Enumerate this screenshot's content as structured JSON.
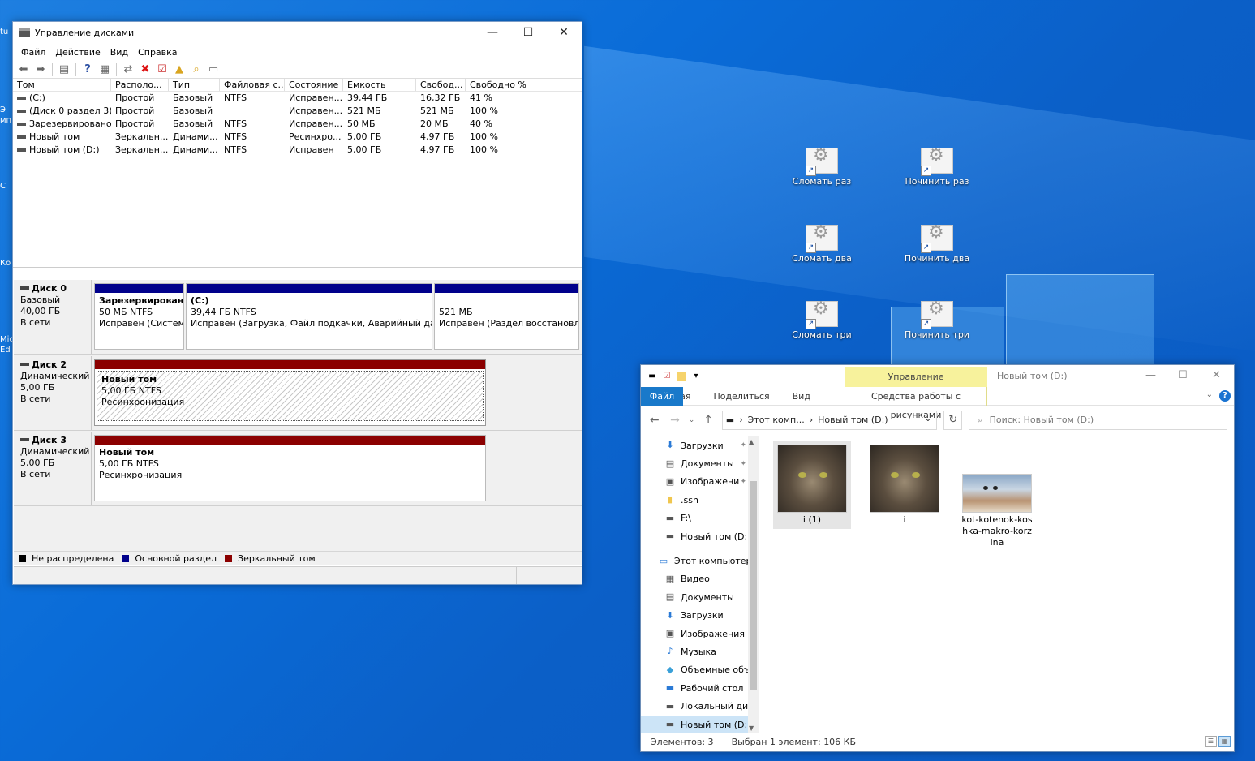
{
  "desktop": {
    "left_edge": [
      "tu",
      "Э",
      "мп",
      "С",
      "Ко",
      "Mic",
      "Ed"
    ],
    "shortcuts": [
      {
        "label": "Сломать раз"
      },
      {
        "label": "Починить раз"
      },
      {
        "label": "Сломать два"
      },
      {
        "label": "Починить два"
      },
      {
        "label": "Сломать три"
      },
      {
        "label": "Починить три"
      }
    ]
  },
  "disk_mgmt": {
    "title": "Управление дисками",
    "window_buttons": {
      "minimize": "—",
      "maximize": "☐",
      "close": "✕"
    },
    "menu": [
      "Файл",
      "Действие",
      "Вид",
      "Справка"
    ],
    "columns": [
      "Том",
      "Располо...",
      "Тип",
      "Файловая с...",
      "Состояние",
      "Емкость",
      "Свобод...",
      "Свободно %"
    ],
    "volumes": [
      [
        "(C:)",
        "Простой",
        "Базовый",
        "NTFS",
        "Исправен...",
        "39,44 ГБ",
        "16,32 ГБ",
        "41 %"
      ],
      [
        "(Диск 0 раздел 3)",
        "Простой",
        "Базовый",
        "",
        "Исправен...",
        "521 МБ",
        "521 МБ",
        "100 %"
      ],
      [
        "Зарезервировано...",
        "Простой",
        "Базовый",
        "NTFS",
        "Исправен...",
        "50 МБ",
        "20 МБ",
        "40 %"
      ],
      [
        "Новый том",
        "Зеркальн...",
        "Динами...",
        "NTFS",
        "Ресинхро...",
        "5,00 ГБ",
        "4,97 ГБ",
        "100 %"
      ],
      [
        "Новый том (D:)",
        "Зеркальн...",
        "Динами...",
        "NTFS",
        "Исправен",
        "5,00 ГБ",
        "4,97 ГБ",
        "100 %"
      ]
    ],
    "disks": [
      {
        "name": "Диск 0",
        "type": "Базовый",
        "size": "40,00 ГБ",
        "status": "В сети",
        "partitions": [
          {
            "name": "Зарезервировано",
            "size": "50 МБ NTFS",
            "state": "Исправен (Система"
          },
          {
            "name": "(C:)",
            "size": "39,44 ГБ NTFS",
            "state": "Исправен (Загрузка, Файл подкачки, Аварийный дамп п"
          },
          {
            "name": "",
            "size": "521 МБ",
            "state": "Исправен (Раздел восстановлен"
          }
        ]
      },
      {
        "name": "Диск 2",
        "type": "Динамический",
        "size": "5,00 ГБ",
        "status": "В сети",
        "partitions": [
          {
            "name": "Новый том",
            "size": "5,00 ГБ NTFS",
            "state": "Ресинхронизация"
          }
        ]
      },
      {
        "name": "Диск 3",
        "type": "Динамический",
        "size": "5,00 ГБ",
        "status": "В сети",
        "partitions": [
          {
            "name": "Новый том",
            "size": "5,00 ГБ NTFS",
            "state": "Ресинхронизация"
          }
        ]
      }
    ],
    "legend": [
      {
        "label": "Не распределена",
        "color": "#000000"
      },
      {
        "label": "Основной раздел",
        "color": "#00008b"
      },
      {
        "label": "Зеркальный том",
        "color": "#8b0000"
      }
    ]
  },
  "explorer": {
    "context_tab": "Управление",
    "title": "Новый том (D:)",
    "ribbon_tabs": [
      "Файл",
      "Главная",
      "Поделиться",
      "Вид"
    ],
    "tools_tab": "Средства работы с рисунками",
    "address": {
      "crumb1": "Этот комп...",
      "crumb2": "Новый том (D:)"
    },
    "search_placeholder": "Поиск: Новый том (D:)",
    "nav": [
      {
        "label": "Загрузки",
        "icon": "download-icon",
        "pinned": true
      },
      {
        "label": "Документы",
        "icon": "document-icon",
        "pinned": true
      },
      {
        "label": "Изображени",
        "icon": "pictures-icon",
        "pinned": true
      },
      {
        "label": ".ssh",
        "icon": "folder-icon",
        "pinned": false
      },
      {
        "label": "F:\\",
        "icon": "drive-icon",
        "pinned": false
      },
      {
        "label": "Новый том (D:)",
        "icon": "drive-icon",
        "pinned": false
      },
      {
        "label": "Этот компьютер",
        "icon": "computer-icon",
        "pinned": false,
        "top": true
      },
      {
        "label": "Видео",
        "icon": "video-icon",
        "pinned": false
      },
      {
        "label": "Документы",
        "icon": "document-icon",
        "pinned": false
      },
      {
        "label": "Загрузки",
        "icon": "download-icon",
        "pinned": false
      },
      {
        "label": "Изображения",
        "icon": "pictures-icon",
        "pinned": false
      },
      {
        "label": "Музыка",
        "icon": "music-icon",
        "pinned": false
      },
      {
        "label": "Объемные объ",
        "icon": "3d-objects-icon",
        "pinned": false
      },
      {
        "label": "Рабочий стол",
        "icon": "desktop-icon",
        "pinned": false
      },
      {
        "label": "Локальный дис",
        "icon": "drive-icon",
        "pinned": false
      },
      {
        "label": "Новый том (D:)",
        "icon": "drive-icon",
        "pinned": false,
        "selected": true
      }
    ],
    "files": [
      {
        "name": "i (1)",
        "selected": true
      },
      {
        "name": "i",
        "selected": false
      },
      {
        "name": "kot-kotenok-koshka-makro-korzina",
        "selected": false
      }
    ],
    "status": {
      "count": "Элементов: 3",
      "selection": "Выбран 1 элемент: 106 КБ"
    }
  }
}
